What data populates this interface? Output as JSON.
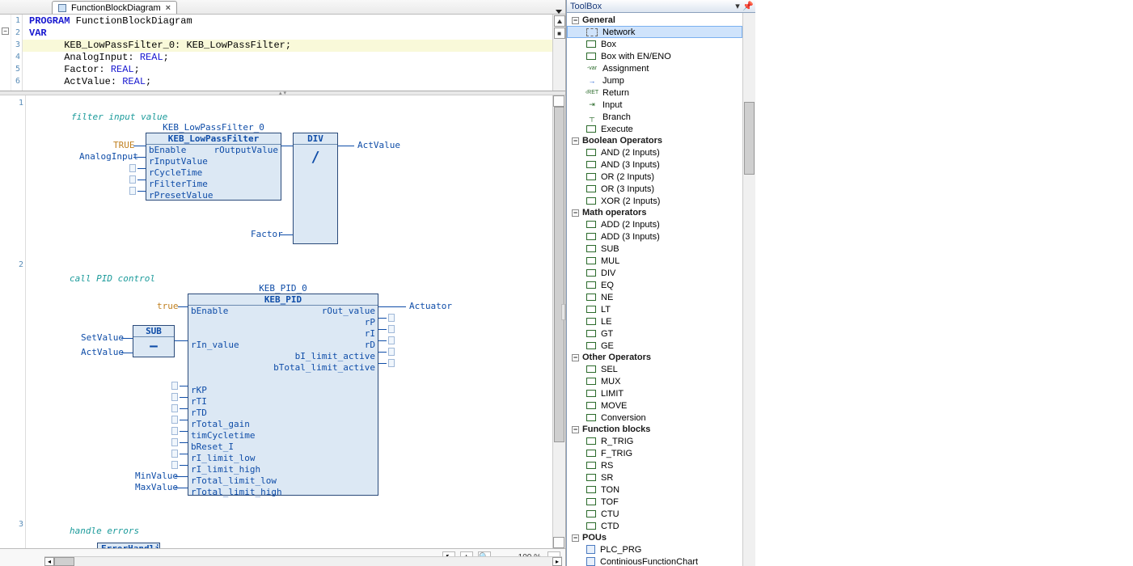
{
  "tab": {
    "title": "FunctionBlockDiagram",
    "close": "×"
  },
  "code": {
    "lines": [
      {
        "n": "1",
        "pre": "   ",
        "kw": "PROGRAM",
        "rest": " FunctionBlockDiagram"
      },
      {
        "n": "2",
        "pre": "   ",
        "kw": "VAR",
        "rest": ""
      },
      {
        "n": "3",
        "pre": "      ",
        "idn": "KEB_LowPassFilter_0: KEB_LowPassFilter;",
        "hl": true
      },
      {
        "n": "4",
        "pre": "      ",
        "idn": "AnalogInput: ",
        "typ": "REAL",
        "tail": ";"
      },
      {
        "n": "5",
        "pre": "      ",
        "idn": "Factor: ",
        "typ": "REAL",
        "tail": ";"
      },
      {
        "n": "6",
        "pre": "      ",
        "idn": "ActValue: ",
        "typ": "REAL",
        "tail": ";"
      }
    ]
  },
  "fbd": {
    "nets": [
      "1",
      "2",
      "3"
    ],
    "comment1": "filter input value",
    "comment2": "call PID control",
    "comment3": "handle errors",
    "inst1": "KEB_LowPassFilter_0",
    "blk1type": "KEB_LowPassFilter",
    "blk1pins_l": [
      "bEnable",
      "rInputValue",
      "rCycleTime",
      "rFilterTime",
      "rPresetValue"
    ],
    "blk1pins_r": [
      "rOutputValue"
    ],
    "divlbl": "DIV",
    "divop": "/",
    "true1": "TRUE",
    "analog": "AnalogInput",
    "factor": "Factor",
    "actvalue": "ActValue",
    "inst2": "KEB_PID_0",
    "blk2type": "KEB_PID",
    "true2": "true",
    "sublbl": "SUB",
    "subop": "−",
    "setvalue": "SetValue",
    "actvalue2": "ActValue",
    "minvalue": "MinValue",
    "maxvalue": "MaxValue",
    "actuator": "Actuator",
    "blk2pins_l": [
      "bEnable",
      "",
      "",
      "rIn_value",
      "",
      "",
      "",
      "rKP",
      "rTI",
      "rTD",
      "rTotal_gain",
      "timCycletime",
      "bReset_I",
      "rI_limit_low",
      "rI_limit_high",
      "rTotal_limit_low",
      "rTotal_limit_high"
    ],
    "blk2pins_r": [
      "rOut_value",
      "rP",
      "rI",
      "rD",
      "bI_limit_active",
      "bTotal_limit_active"
    ],
    "errhandling": "ErrorHandling"
  },
  "status": {
    "zoom": "100 %"
  },
  "toolbox": {
    "title": "ToolBox",
    "cats": {
      "general": "General",
      "boolean": "Boolean Operators",
      "math": "Math operators",
      "other": "Other Operators",
      "fb": "Function blocks",
      "pous": "POUs"
    },
    "general_items": [
      "Network",
      "Box",
      "Box with EN/ENO",
      "Assignment",
      "Jump",
      "Return",
      "Input",
      "Branch",
      "Execute"
    ],
    "bool_items": [
      "AND (2 Inputs)",
      "AND (3 Inputs)",
      "OR (2 Inputs)",
      "OR (3 Inputs)",
      "XOR (2 Inputs)"
    ],
    "math_items": [
      "ADD (2 Inputs)",
      "ADD (3 Inputs)",
      "SUB",
      "MUL",
      "DIV",
      "EQ",
      "NE",
      "LT",
      "LE",
      "GT",
      "GE"
    ],
    "other_items": [
      "SEL",
      "MUX",
      "LIMIT",
      "MOVE",
      "Conversion"
    ],
    "fb_items": [
      "R_TRIG",
      "F_TRIG",
      "RS",
      "SR",
      "TON",
      "TOF",
      "CTU",
      "CTD"
    ],
    "pou_items": [
      "PLC_PRG",
      "ContiniousFunctionChart"
    ]
  }
}
